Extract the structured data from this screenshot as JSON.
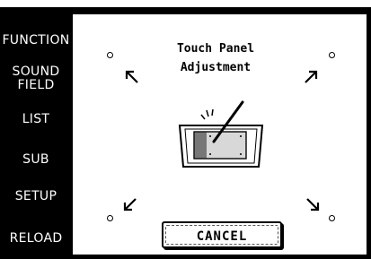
{
  "side_menu": {
    "items": [
      {
        "line1": "FUNCTION",
        "line2": ""
      },
      {
        "line1": "SOUND",
        "line2": "FIELD"
      },
      {
        "line1": "LIST",
        "line2": ""
      },
      {
        "line1": "SUB",
        "line2": ""
      },
      {
        "line1": "SETUP",
        "line2": ""
      },
      {
        "line1": "RELOAD",
        "line2": ""
      }
    ]
  },
  "dialog": {
    "title_line1": "Touch Panel",
    "title_line2": "Adjustment",
    "cancel_label": "CANCEL"
  }
}
